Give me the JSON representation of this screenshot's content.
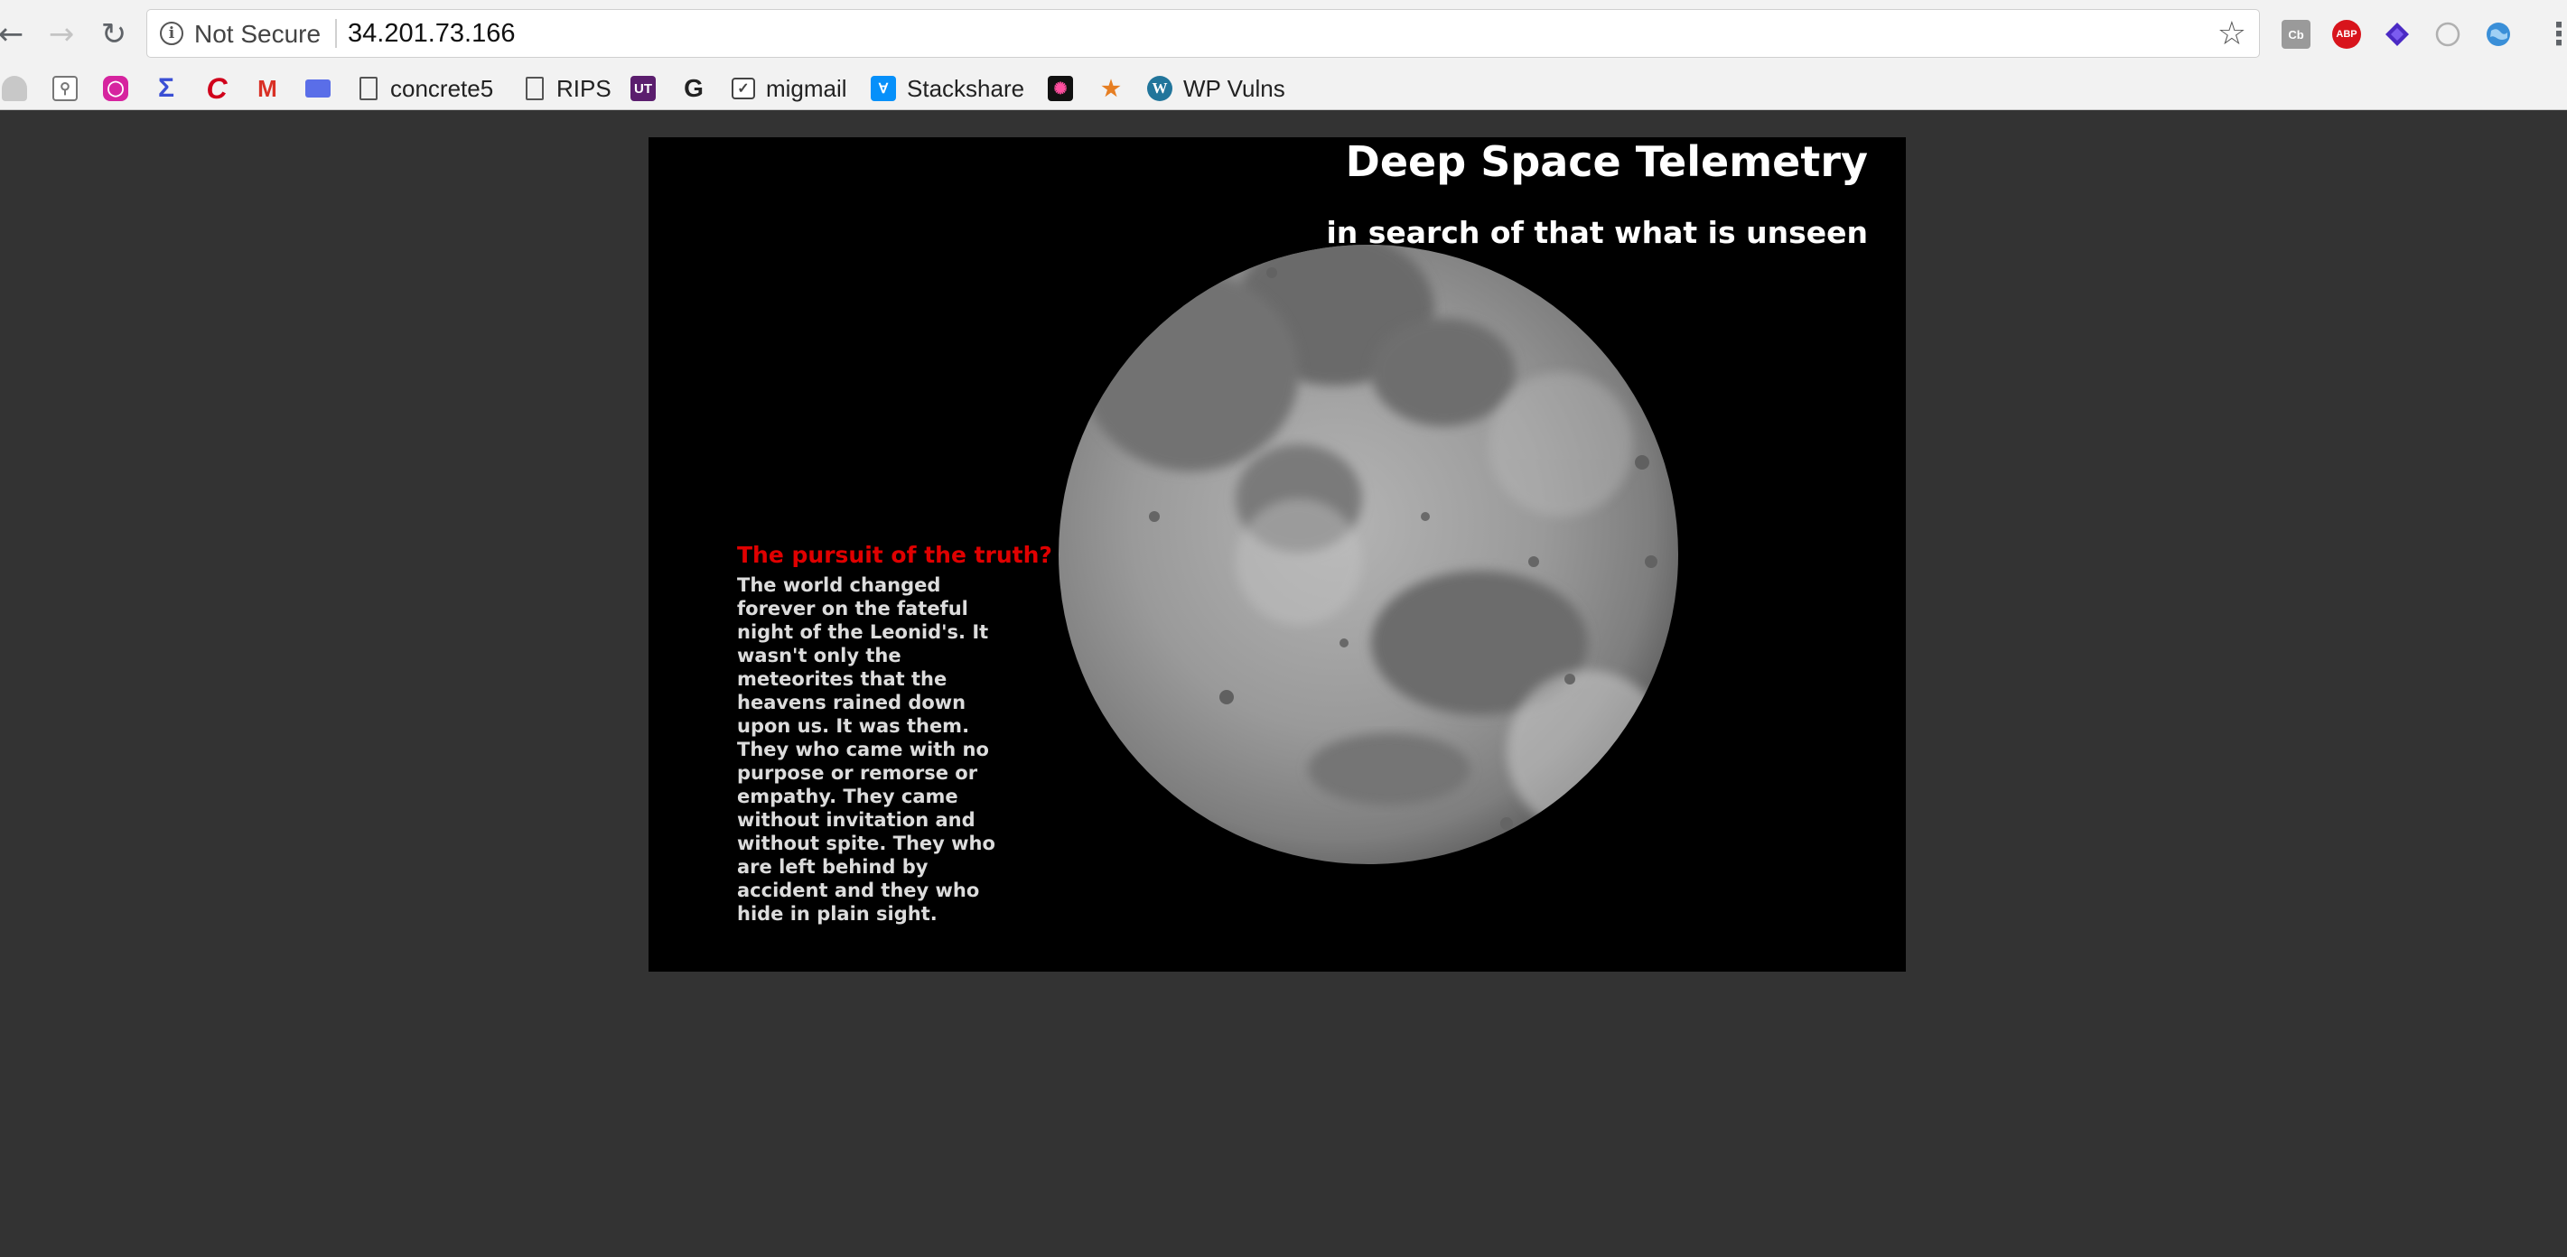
{
  "browser": {
    "security_label": "Not Secure",
    "url": "34.201.73.166",
    "bookmarks": [
      {
        "label": "concrete5"
      },
      {
        "label": "RIPS"
      },
      {
        "label": "migmail"
      },
      {
        "label": "Stackshare"
      },
      {
        "label": "WP Vulns"
      }
    ],
    "extension_labels": {
      "cb": "Cb",
      "abp": "ABP"
    }
  },
  "hero": {
    "title": "Deep Space Telemetry",
    "subtitle": "in search of that what is unseen",
    "story_heading": "The pursuit of the truth?",
    "story_body": "The world changed forever on the fateful night of the Leonid's. It wasn't only the meteorites that the heavens rained down upon us. It was them. They who came with no purpose or remorse or empathy. They came without invitation and without spite. They who are left behind by accident and they who hide in plain sight.",
    "image_subject": "moon"
  },
  "colors": {
    "page_background": "#333333",
    "hero_background": "#000000",
    "heading_red": "#e00000",
    "text_white": "#ffffff"
  }
}
